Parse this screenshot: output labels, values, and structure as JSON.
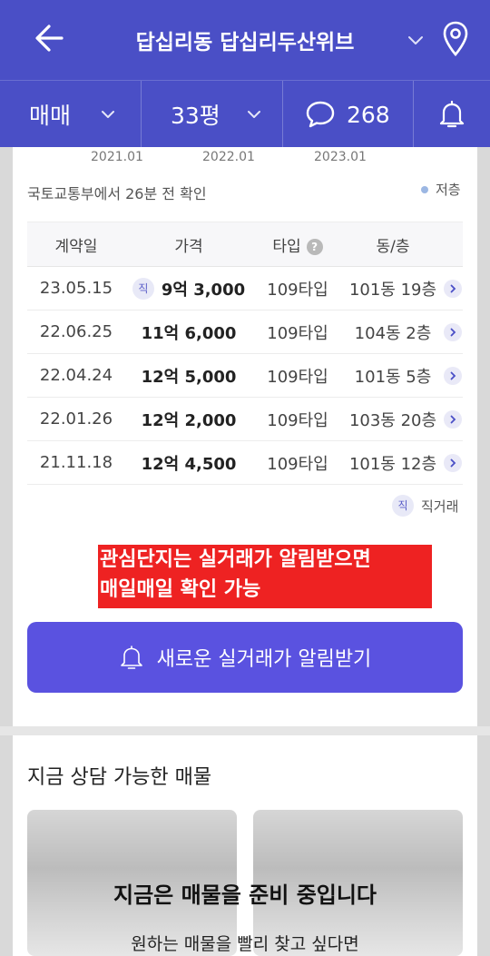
{
  "header": {
    "title": "답십리동 답십리두산위브",
    "filters": {
      "trade_type": "매매",
      "size": "33평",
      "comments_count": "268"
    },
    "bg_color": "#4a4fc6"
  },
  "timeline": {
    "labels": [
      "2021.01",
      "2022.01",
      "2023.01"
    ]
  },
  "source_note": "국토교통부에서 26분 전 확인",
  "legend_low_floor": "저층",
  "table": {
    "headers": [
      "계약일",
      "가격",
      "타입",
      "동/층"
    ],
    "rows": [
      {
        "date": "23.05.15",
        "direct": "직",
        "price": "9억 3,000",
        "type": "109타입",
        "unit": "101동 19층"
      },
      {
        "date": "22.06.25",
        "direct": "",
        "price": "11억 6,000",
        "type": "109타입",
        "unit": "104동 2층"
      },
      {
        "date": "22.04.24",
        "direct": "",
        "price": "12억 5,000",
        "type": "109타입",
        "unit": "101동 5층"
      },
      {
        "date": "22.01.26",
        "direct": "",
        "price": "12억 2,000",
        "type": "109타입",
        "unit": "103동 20층"
      },
      {
        "date": "21.11.18",
        "direct": "",
        "price": "12억 4,500",
        "type": "109타입",
        "unit": "101동 12층"
      }
    ]
  },
  "legend_direct": {
    "badge": "직",
    "label": "직거래"
  },
  "note": {
    "line1": "관심단지는 실거래가 알림받으면",
    "line2": "매일매일 확인 가능"
  },
  "alert_button": "새로운 실거래가 알림받기",
  "listings": {
    "title": "지금 상담 가능한 매물",
    "empty_title": "지금은 매물을 준비 중입니다",
    "empty_sub": "원하는 매물을 빨리 찾고 싶다면"
  }
}
